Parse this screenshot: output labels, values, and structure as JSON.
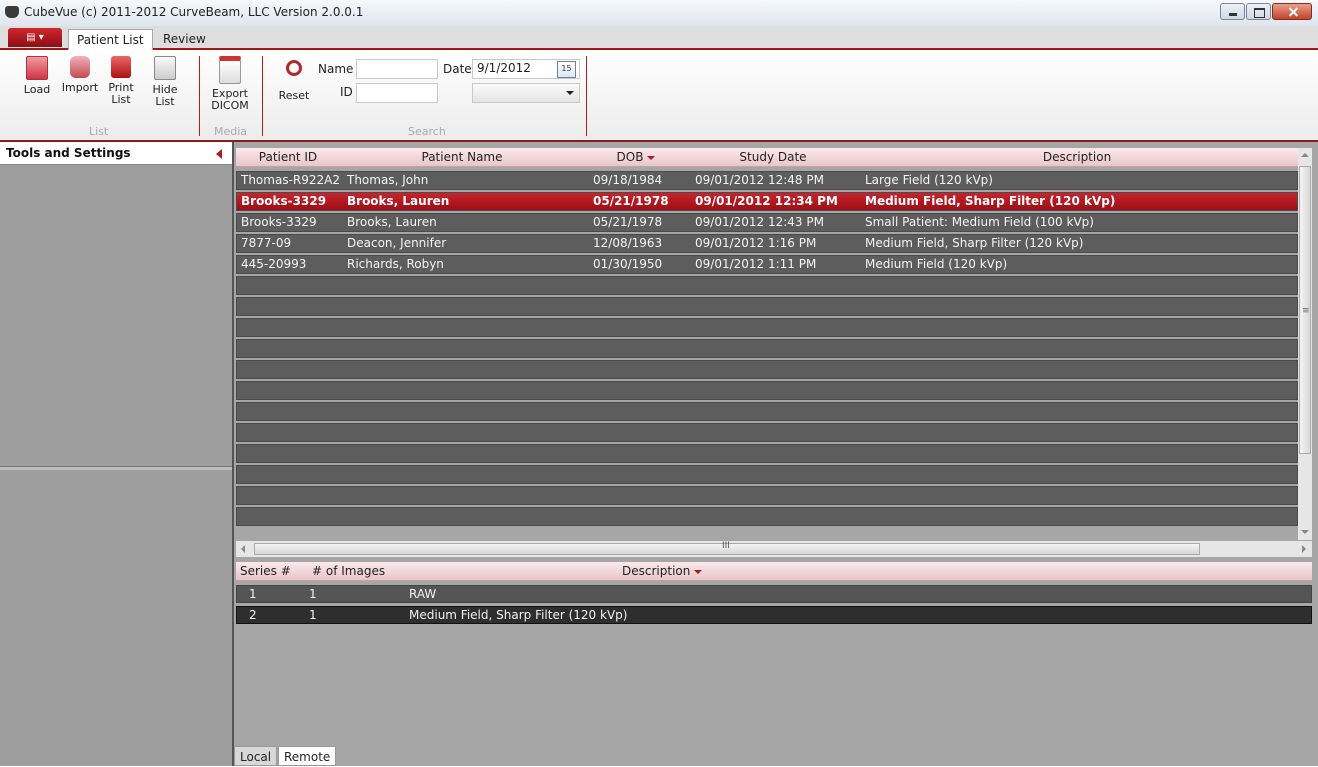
{
  "window": {
    "title": "CubeVue (c) 2011-2012 CurveBeam, LLC  Version 2.0.0.1"
  },
  "ribbon": {
    "tabs": [
      {
        "label": "Patient List"
      },
      {
        "label": "Review"
      }
    ],
    "buttons": {
      "load": "Load",
      "import": "Import",
      "print": "Print List",
      "hide": "Hide List",
      "export": "Export DICOM",
      "reset": "Reset"
    },
    "groups": {
      "list": "List",
      "media": "Media",
      "search": "Search"
    },
    "search": {
      "name_label": "Name",
      "name_value": "",
      "id_label": "ID",
      "id_value": "",
      "date_label": "Date",
      "date_value": "9/1/2012",
      "calendar_day": "15",
      "dropdown_value": ""
    }
  },
  "left_panel": {
    "title": "Tools and Settings"
  },
  "patients": {
    "columns": [
      "Patient ID",
      "Patient Name",
      "DOB",
      "Study Date",
      "Description"
    ],
    "sort_column": "DOB",
    "rows": [
      {
        "id": "Thomas-R922A2",
        "name": "Thomas, John",
        "dob": "09/18/1984",
        "study": "09/01/2012 12:48 PM",
        "desc": "Large Field (120 kVp)",
        "selected": false
      },
      {
        "id": "Brooks-3329",
        "name": "Brooks, Lauren",
        "dob": "05/21/1978",
        "study": "09/01/2012 12:34 PM",
        "desc": "Medium Field, Sharp Filter (120 kVp)",
        "selected": true
      },
      {
        "id": "Brooks-3329",
        "name": "Brooks, Lauren",
        "dob": "05/21/1978",
        "study": "09/01/2012 12:43 PM",
        "desc": "Small Patient: Medium Field (100 kVp)",
        "selected": false
      },
      {
        "id": "7877-09",
        "name": "Deacon, Jennifer",
        "dob": "12/08/1963",
        "study": "09/01/2012 1:16 PM",
        "desc": "Medium Field, Sharp Filter (120 kVp)",
        "selected": false
      },
      {
        "id": "445-20993",
        "name": "Richards, Robyn",
        "dob": "01/30/1950",
        "study": "09/01/2012 1:11 PM",
        "desc": "Medium Field (120 kVp)",
        "selected": false
      }
    ]
  },
  "series": {
    "columns": [
      "Series #",
      "# of Images",
      "Description"
    ],
    "sort_column": "Description",
    "rows": [
      {
        "num": "1",
        "images": "1",
        "desc": "RAW",
        "selected": false
      },
      {
        "num": "2",
        "images": "1",
        "desc": "Medium Field, Sharp Filter (120 kVp)",
        "selected": true
      }
    ]
  },
  "bottom_tabs": [
    {
      "label": "Local"
    },
    {
      "label": "Remote"
    }
  ],
  "scrollbar_glyph": "≡",
  "hscroll_glyph": "III",
  "colors": {
    "accent": "#b21a1a",
    "selected_row": "#c8242c",
    "row": "#5d5d5d"
  }
}
